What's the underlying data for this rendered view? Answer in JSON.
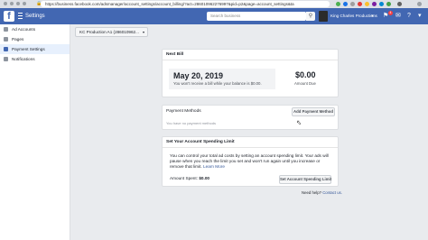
{
  "browser": {
    "url": "https://business.facebook.com/adsmanager/account_settings/account_billing/?act=286010962276997&pid=p2&page=account_settings&ta"
  },
  "topbar": {
    "title": "Settings",
    "search_placeholder": "Search business",
    "account_name": "King Charles Productions",
    "notification_count": "4"
  },
  "sidebar": {
    "items": [
      {
        "label": "Ad Accounts",
        "icon": "ad-accounts-icon"
      },
      {
        "label": "Pages",
        "icon": "pages-icon"
      },
      {
        "label": "Payment Settings",
        "icon": "payment-icon"
      },
      {
        "label": "Notifications",
        "icon": "notifications-icon"
      }
    ]
  },
  "account_selector": {
    "value": "KC Production A1 (28601096​2..."
  },
  "next_bill": {
    "heading": "Next Bill",
    "date": "May 20, 2019",
    "note": "You won't receive a bill while your balance is $0.00.",
    "amount": "$0.00",
    "amount_label": "Amount Due"
  },
  "payment_methods": {
    "heading": "Payment Methods",
    "add_button": "Add Payment Method",
    "empty_note": "You have no payment methods"
  },
  "spending_limit": {
    "heading": "Set Your Account Spending Limit",
    "description": "You can control your total ad costs by setting an account spending limit. Your ads will pause when you reach the limit you set and won't run again until you increase or remove that limit. ",
    "learn_more": "Learn More",
    "spent_label": "Amount Spent: ",
    "spent_value": "$0.00",
    "button": "Set Account Spending Limit"
  },
  "help": {
    "prefix": "Need help? ",
    "link": "Contact us."
  },
  "colors": {
    "brand": "#4267b2",
    "background": "#e9ebee",
    "link": "#365899"
  }
}
